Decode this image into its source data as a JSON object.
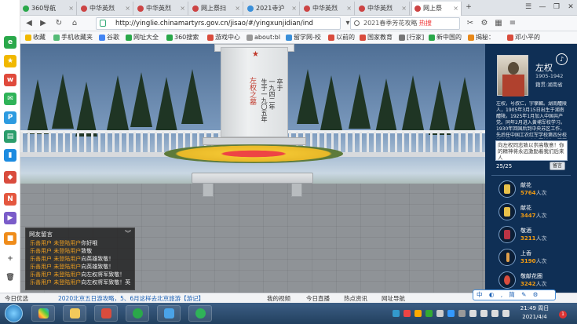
{
  "browser": {
    "tabs": [
      {
        "label": "360导航",
        "active": false
      },
      {
        "label": "中华英烈",
        "active": false
      },
      {
        "label": "中华英烈",
        "active": false
      },
      {
        "label": "网上祭扫",
        "active": false
      },
      {
        "label": "2021寺沪",
        "active": false
      },
      {
        "label": "中华英烈",
        "active": false
      },
      {
        "label": "中华英烈",
        "active": false
      },
      {
        "label": "网上祭",
        "active": true
      }
    ],
    "window_controls": [
      "☰",
      "—",
      "❐",
      "✕"
    ],
    "address": "http://yinglie.chinamartyrs.gov.cn/jisao/#/yingxunjidian/ind",
    "search_text": "2021春季芳花攻略",
    "search_hot": "热搜",
    "bookmarks": [
      "收藏",
      "手机收藏夹",
      "谷歌",
      "网址大全",
      "360搜索",
      "游戏中心",
      "about:bl",
      "留学网-校",
      "以前的",
      "国家教育",
      "[行家]",
      "新中国的",
      "揭秘：",
      "邓小平的"
    ]
  },
  "scene": {
    "inscription_red": "左权之墓",
    "inscription_col1": "一九四二年",
    "inscription_col2": "生于一九〇五年",
    "inscription_col3": "卒于"
  },
  "chat": {
    "title": "网友留言",
    "messages": [
      {
        "user": "乐善用户 未登陆用户",
        "msg": "你好哦"
      },
      {
        "user": "乐善用户 未登陆用户",
        "msg": "致敬"
      },
      {
        "user": "乐善用户 未登陆用户",
        "msg": "向英雄致敬！"
      },
      {
        "user": "乐善用户 未登陆用户",
        "msg": "向英雄致敬！"
      },
      {
        "user": "乐善用户 未登陆用户",
        "msg": "向左权将军致敬！"
      },
      {
        "user": "乐善用户 未登陆用户",
        "msg": "向左权将军致敬！英"
      }
    ]
  },
  "hero": {
    "name": "左权",
    "years": "1905-1942",
    "place": "籍贯:湖南省",
    "bio": "左权，号叔仁，字孳麟。湖南醴陵人，1905年3月15日出生于湖南醴陵。1925年1月加入中国共产党。同年2月进入黄埔军校学习。1930年回国后到中央苏区工作，先后任中国工农红军学校第四分校教育长、中国工农红军新十二军军长……",
    "message_placeholder": "向左权同志致以崇高敬意！你的精神将永远激励着我们后来人",
    "count": "25/25",
    "send_label": "留言"
  },
  "tributes": [
    {
      "name": "献花",
      "count": "5764",
      "unit": "人次"
    },
    {
      "name": "献花",
      "count": "3447",
      "unit": "人次"
    },
    {
      "name": "敬酒",
      "count": "3211",
      "unit": "人次"
    },
    {
      "name": "上香",
      "count": "3190",
      "unit": "人次"
    },
    {
      "name": "敬献花圈",
      "count": "3242",
      "unit": "人次"
    }
  ],
  "status_bar": {
    "left": "今日优选",
    "news": "2020北京五日游攻略，5、6月这样去北京旅游【游记】",
    "items": [
      "我的视频",
      "今日直播",
      "热点资讯",
      "网址导航"
    ],
    "ime": "中 ◐ ⸲ 简 ✎ ⚙"
  },
  "taskbar": {
    "time": "21:49 周日",
    "date": "2021/4/4",
    "notif": "1"
  }
}
